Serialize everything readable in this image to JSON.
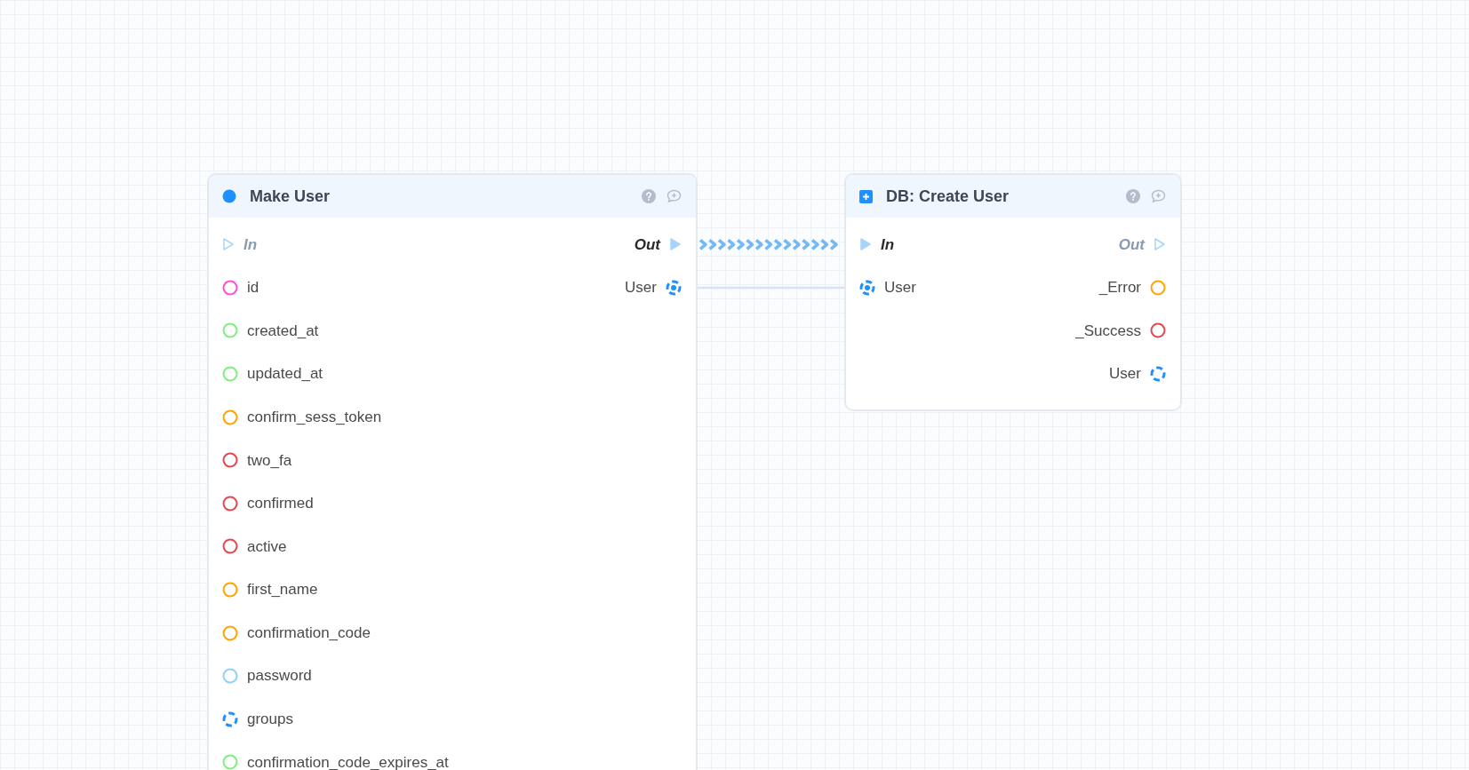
{
  "nodes": [
    {
      "title": "Make User",
      "kind": "event",
      "rows": [
        {
          "left": {
            "label": "In",
            "kind": "exec",
            "connected": false
          },
          "right": {
            "label": "Out",
            "kind": "exec",
            "connected": true
          }
        },
        {
          "left": {
            "label": "id",
            "kind": "data",
            "color": "#ff4fd8",
            "connected": false
          },
          "right": {
            "label": "User",
            "kind": "struct",
            "color": "#1e90ff",
            "connected": true
          }
        },
        {
          "left": {
            "label": "created_at",
            "kind": "data",
            "color": "#7ef07e",
            "connected": false
          }
        },
        {
          "left": {
            "label": "updated_at",
            "kind": "data",
            "color": "#7ef07e",
            "connected": false
          }
        },
        {
          "left": {
            "label": "confirm_sess_token",
            "kind": "data",
            "color": "#ffa500",
            "connected": false
          }
        },
        {
          "left": {
            "label": "two_fa",
            "kind": "data",
            "color": "#e5484d",
            "connected": false
          }
        },
        {
          "left": {
            "label": "confirmed",
            "kind": "data",
            "color": "#e5484d",
            "connected": false
          }
        },
        {
          "left": {
            "label": "active",
            "kind": "data",
            "color": "#e5484d",
            "connected": false
          }
        },
        {
          "left": {
            "label": "first_name",
            "kind": "data",
            "color": "#ffa500",
            "connected": false
          }
        },
        {
          "left": {
            "label": "confirmation_code",
            "kind": "data",
            "color": "#ffa500",
            "connected": false
          }
        },
        {
          "left": {
            "label": "password",
            "kind": "data",
            "color": "#90d0ff",
            "connected": false
          }
        },
        {
          "left": {
            "label": "groups",
            "kind": "struct",
            "color": "#1e90ff",
            "connected": false
          }
        },
        {
          "left": {
            "label": "confirmation_code_expires_at",
            "kind": "data",
            "color": "#7ef07e",
            "connected": false
          }
        }
      ]
    },
    {
      "title": "DB: Create User",
      "kind": "function",
      "rows": [
        {
          "left": {
            "label": "In",
            "kind": "exec",
            "connected": true
          },
          "right": {
            "label": "Out",
            "kind": "exec",
            "connected": false
          }
        },
        {
          "left": {
            "label": "User",
            "kind": "struct",
            "color": "#1e90ff",
            "connected": true
          },
          "right": {
            "label": "_Error",
            "kind": "data",
            "color": "#ffa500",
            "connected": false
          }
        },
        {
          "right": {
            "label": "_Success",
            "kind": "data",
            "color": "#e5484d",
            "connected": false
          }
        },
        {
          "right": {
            "label": "User",
            "kind": "struct",
            "color": "#1e90ff",
            "connected": false
          }
        }
      ]
    }
  ],
  "links": [
    {
      "kind": "exec"
    },
    {
      "kind": "data"
    }
  ]
}
